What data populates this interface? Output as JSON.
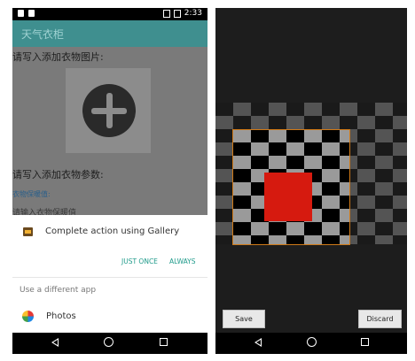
{
  "left": {
    "status": {
      "time": "2:33"
    },
    "app_title": "天气衣柜",
    "form": {
      "image_label": "请写入添加衣物图片:",
      "params_label": "请写入添加衣物参数:",
      "warmth_label": "衣物保暖值:",
      "warmth_placeholder": "请输入衣物保暖值"
    },
    "chooser": {
      "title": "Complete action using Gallery",
      "just_once": "JUST ONCE",
      "always": "ALWAYS",
      "different_app": "Use a different app",
      "photos": "Photos"
    },
    "icons": [
      "gallery-icon",
      "photos-pinwheel-icon",
      "add-image-icon"
    ]
  },
  "right": {
    "save": "Save",
    "discard": "Discard",
    "colors": {
      "crop_border": "#d07a18",
      "selection": "#d61a0f"
    }
  },
  "nav": [
    "back-icon",
    "home-icon",
    "recents-icon"
  ]
}
